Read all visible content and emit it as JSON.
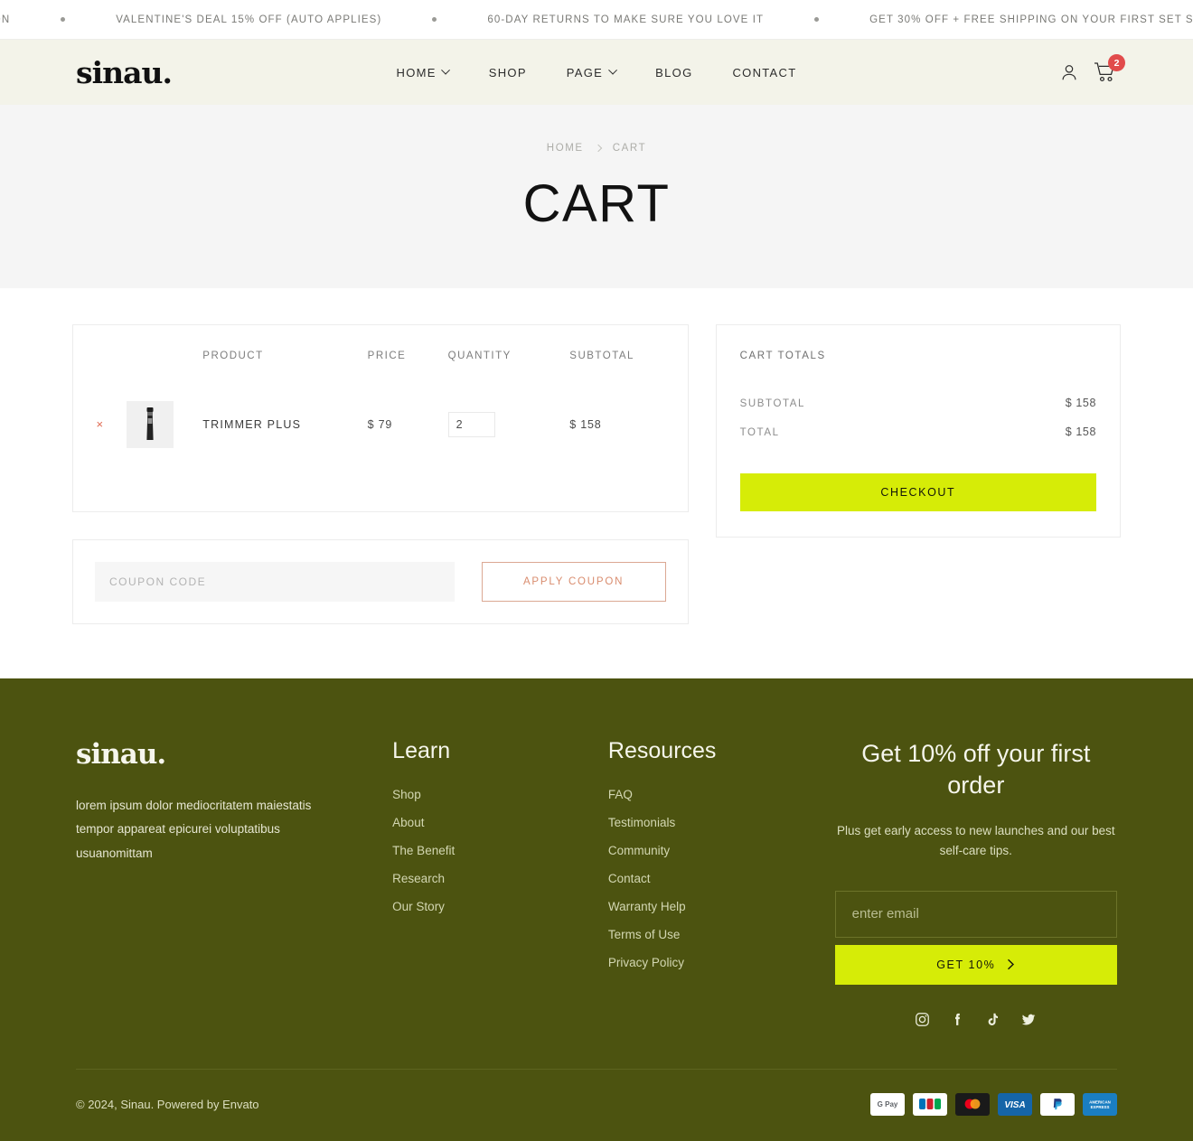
{
  "ticker": {
    "items": [
      "NG ON YOUR FIRST SET SUBSCRIPTION",
      "VALENTINE'S DEAL 15% OFF (AUTO APPLIES)",
      "60-DAY RETURNS TO MAKE SURE YOU LOVE IT",
      "GET 30% OFF + FREE SHIPPING ON YOUR FIRST SET S"
    ]
  },
  "header": {
    "logo": "sinau.",
    "nav": [
      {
        "label": "HOME",
        "has_dropdown": true
      },
      {
        "label": "SHOP",
        "has_dropdown": false
      },
      {
        "label": "PAGE",
        "has_dropdown": true
      },
      {
        "label": "BLOG",
        "has_dropdown": false
      },
      {
        "label": "CONTACT",
        "has_dropdown": false
      }
    ],
    "account_icon": "user-icon",
    "cart_icon": "shopping-cart-icon",
    "cart_count": "2",
    "badge_color": "#e14b4b"
  },
  "hero": {
    "breadcrumb": [
      "HOME",
      "CART"
    ],
    "title": "CART"
  },
  "cart": {
    "columns": {
      "product": "PRODUCT",
      "price": "PRICE",
      "quantity": "QUANTITY",
      "subtotal": "SUBTOTAL"
    },
    "items": [
      {
        "remove": "×",
        "image": "trimmer-product-thumbnail",
        "name": "TRIMMER PLUS",
        "price": "$ 79",
        "quantity": "2",
        "subtotal": "$ 158"
      }
    ]
  },
  "coupon": {
    "placeholder": "COUPON CODE",
    "value": "",
    "apply_label": "APPLY COUPON",
    "accent": "#d98c6e"
  },
  "totals": {
    "title": "CART TOTALS",
    "rows": [
      {
        "label": "SUBTOTAL",
        "value": "$ 158"
      },
      {
        "label": "TOTAL",
        "value": "$ 158"
      }
    ],
    "checkout_label": "CHECKOUT",
    "checkout_color": "#d6ec07"
  },
  "footer": {
    "logo": "sinau.",
    "description": "lorem ipsum dolor mediocritatem maiestatis tempor appareat epicurei voluptatibus usuanomittam",
    "learn": {
      "title": "Learn",
      "links": [
        "Shop",
        "About",
        "The Benefit",
        "Research",
        "Our Story"
      ]
    },
    "resources": {
      "title": "Resources",
      "links": [
        "FAQ",
        "Testimonials",
        "Community",
        "Contact",
        "Warranty Help",
        "Terms of Use",
        "Privacy Policy"
      ]
    },
    "newsletter": {
      "title": "Get 10% off your first order",
      "subtitle": "Plus get early access to new launches and our best self-care tips.",
      "placeholder": "enter email",
      "value": "",
      "button_label": "GET 10%"
    },
    "socials": [
      "instagram-icon",
      "facebook-icon",
      "tiktok-icon",
      "twitter-icon"
    ],
    "copyright": "© 2024, Sinau. Powered by Envato",
    "payments": [
      "google-pay",
      "jcb",
      "mastercard",
      "visa",
      "paypal",
      "american-express"
    ],
    "background": "#4c5310"
  }
}
